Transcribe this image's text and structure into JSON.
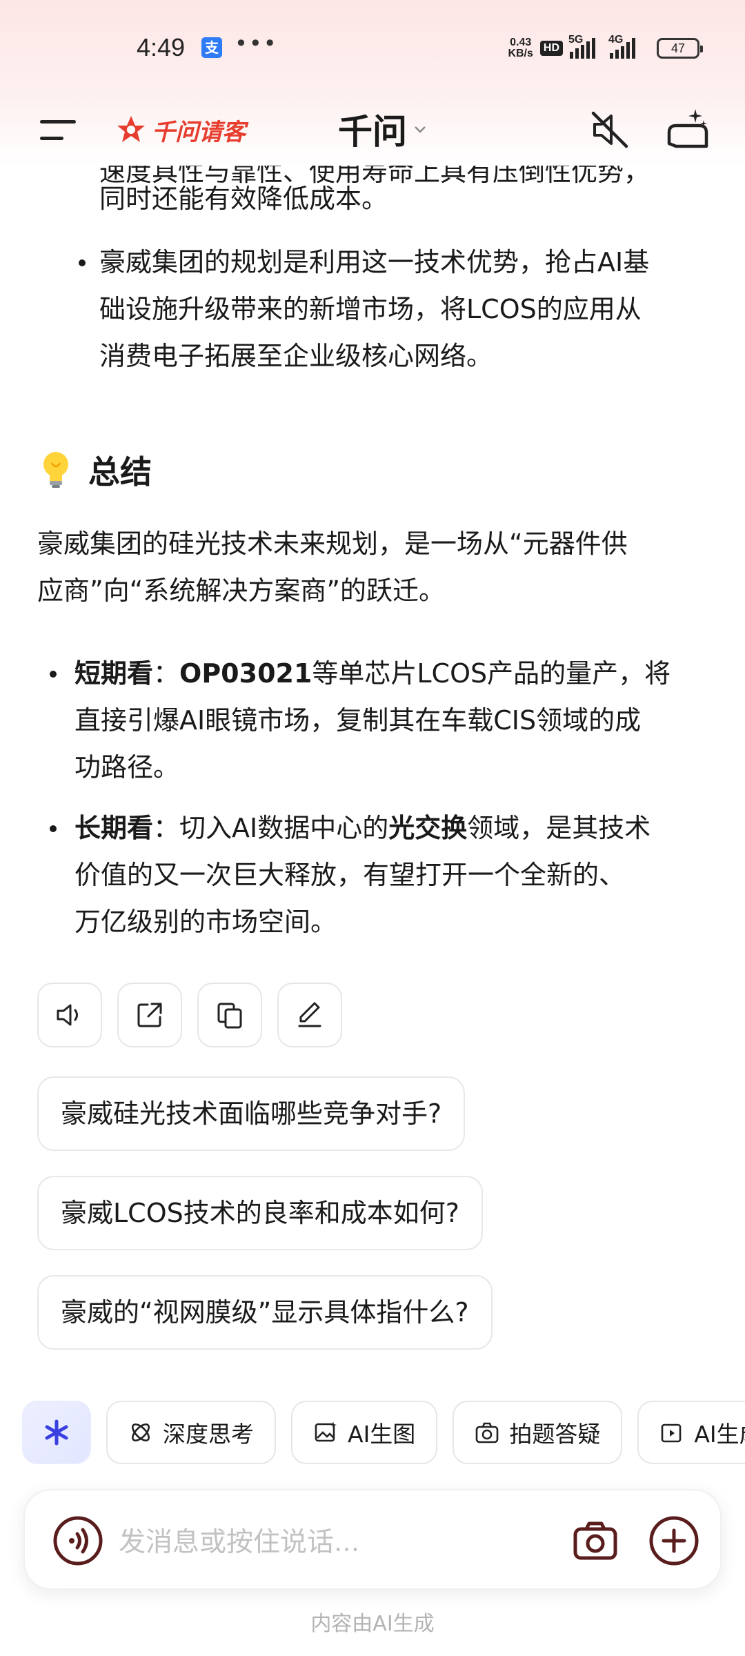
{
  "status": {
    "time": "4:49",
    "net_speed_value": "0.43",
    "net_speed_unit": "KB/s",
    "hd": "HD",
    "sig1": "5G",
    "sig2": "4G",
    "battery": "47"
  },
  "header": {
    "brand": "千问请客",
    "title": "千问"
  },
  "content": {
    "partial_top": "速度具性与靠性、使用寿命上具有压倒性优势，",
    "prev_tail": "同时还能有效降低成本。",
    "prev_bullet_lines": [
      "豪威集团的规划是利用这一技术优势，抢占AI基",
      "础设施升级带来的新增市场，将LCOS的应用从",
      "消费电子拓展至企业级核心网络。"
    ],
    "summary_title": "总结",
    "summary_lines": [
      "豪威集团的硅光技术未来规划，是一场从“元器件供",
      "应商”向“系统解决方案商”的跃迁。"
    ],
    "bullets": [
      {
        "label": "短期看",
        "sep": "：",
        "bold2": "OP03021",
        "line1_rest": "等单芯片LCOS产品的量产，将",
        "line2": "直接引爆AI眼镜市场，复制其在车载CIS领域的成",
        "line3": "功路径。"
      },
      {
        "label": "长期看",
        "sep": "：切入AI数据中心的",
        "bold2": "光交换",
        "line1_rest": "领域，是其技术",
        "line2": "价值的又一次巨大释放，有望打开一个全新的、",
        "line3": "万亿级别的市场空间。"
      }
    ]
  },
  "suggestions": [
    "豪威硅光技术面临哪些竞争对手?",
    "豪威LCOS技术的良率和成本如何?",
    "豪威的“视网膜级”显示具体指什么?"
  ],
  "tools": {
    "deep_think": "深度思考",
    "ai_image": "AI生图",
    "photo_qa": "拍题答疑",
    "ai_more": "AI生成"
  },
  "input": {
    "placeholder": "发消息或按住说话..."
  },
  "footer": "内容由AI生成",
  "colors": {
    "brand_red": "#e63d2e",
    "header_bg": "#fde6e6",
    "accent_blue": "#3a3fe0"
  }
}
